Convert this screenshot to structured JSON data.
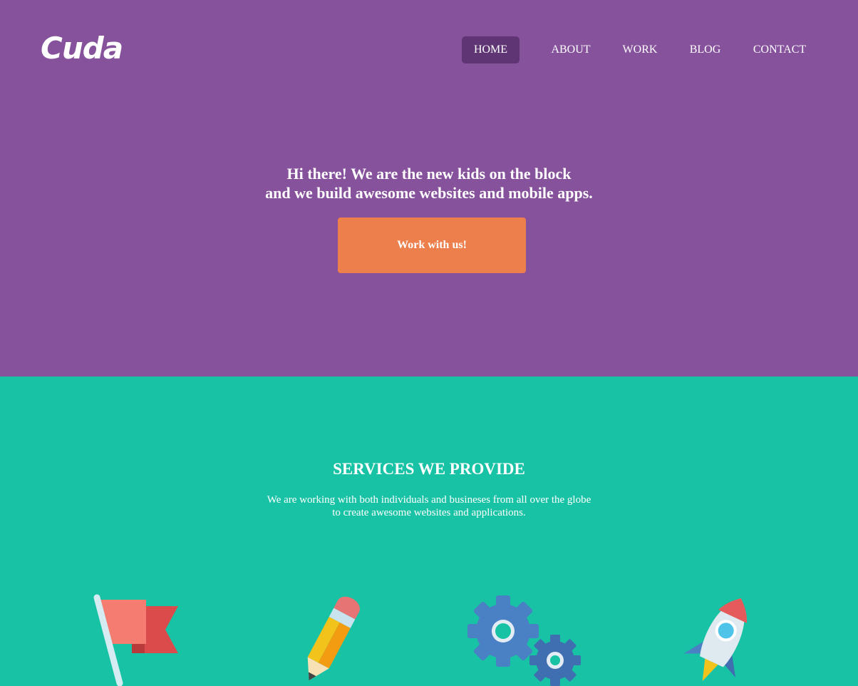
{
  "header": {
    "logo": "Cuda",
    "nav": [
      {
        "label": "HOME",
        "active": true
      },
      {
        "label": "ABOUT",
        "active": false
      },
      {
        "label": "WORK",
        "active": false
      },
      {
        "label": "BLOG",
        "active": false
      },
      {
        "label": "CONTACT",
        "active": false
      }
    ]
  },
  "hero": {
    "line1": "Hi there! We are the new kids on the block",
    "line2": "and we build awesome websites and mobile apps.",
    "cta_label": "Work with us!"
  },
  "services": {
    "title": "SERVICES WE PROVIDE",
    "desc_line1": "We are working with both individuals and busineses from all over the globe",
    "desc_line2": "to create awesome websites and applications.",
    "icons": [
      "flag-icon",
      "pencil-icon",
      "gears-icon",
      "rocket-icon"
    ]
  },
  "colors": {
    "hero_bg": "#87529c",
    "nav_active_bg": "#5f3574",
    "cta_bg": "#ed7f4c",
    "services_bg": "#18c2a4"
  }
}
